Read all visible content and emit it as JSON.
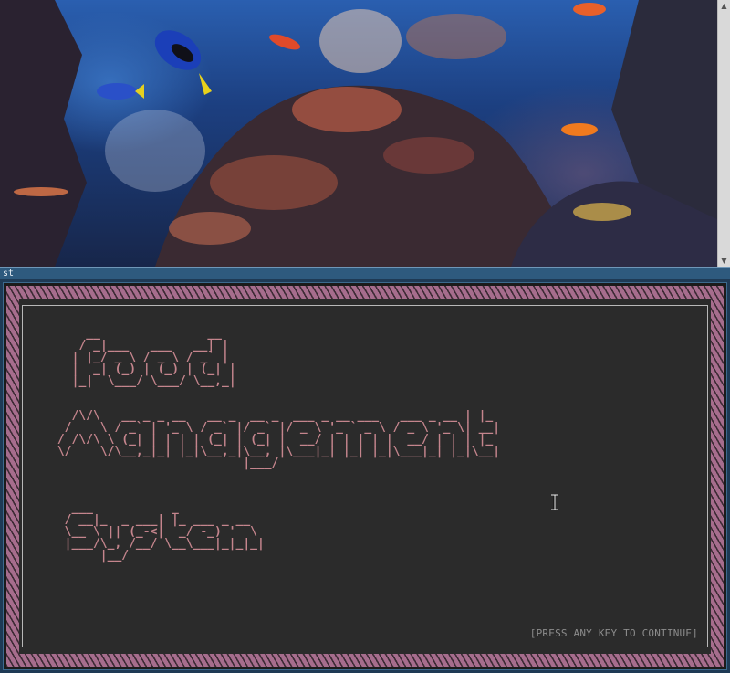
{
  "window": {
    "title": "st"
  },
  "video": {
    "scrollbar_up": "▲",
    "scrollbar_down": "▼"
  },
  "terminal": {
    "ascii_title_words": [
      "Food",
      "Management",
      "System"
    ],
    "ascii_art": {
      "word1": "    __               __\n   / _|___   ___   __| |\n  | |_/ _ \\ / _ \\ / _` |\n  |  _| (_) | (_) | (_| |\n  |_|  \\___/ \\___/ \\__,_|",
      "word2": "   /\\/\\   __ _ _ __   __ _  __ _  ___ _ __ ___   ___ _ __ | |_\n  /    \\ / _` | '_ \\ / _` |/ _` |/ _ \\ '_ ` _ \\ / _ \\ '_ \\| __|\n / /\\/\\ \\ (_| | | | | (_| | (_| |  __/ | | | | |  __/ | | | |_\n \\/    \\/\\__,_|_| |_|\\__,_|\\__, |\\___|_| |_| |_|\\___|_| |_|\\__|\n                           |___/",
      "word3": "   ___           _\n  / __|_  _ ___| |_ ___ _ __\n  \\__ \\ || (_-<|  _/ -_) '  \\\n  |___/\\_, /__/ \\__\\___|_|_|_|\n       |__/"
    },
    "press_key_prompt": "[PRESS ANY KEY TO CONTINUE]"
  },
  "colors": {
    "ascii_text": "#c5858d",
    "frame": "#a66d8d",
    "panel": "#2b2b2b",
    "title_strip": "#2e5a7e"
  }
}
